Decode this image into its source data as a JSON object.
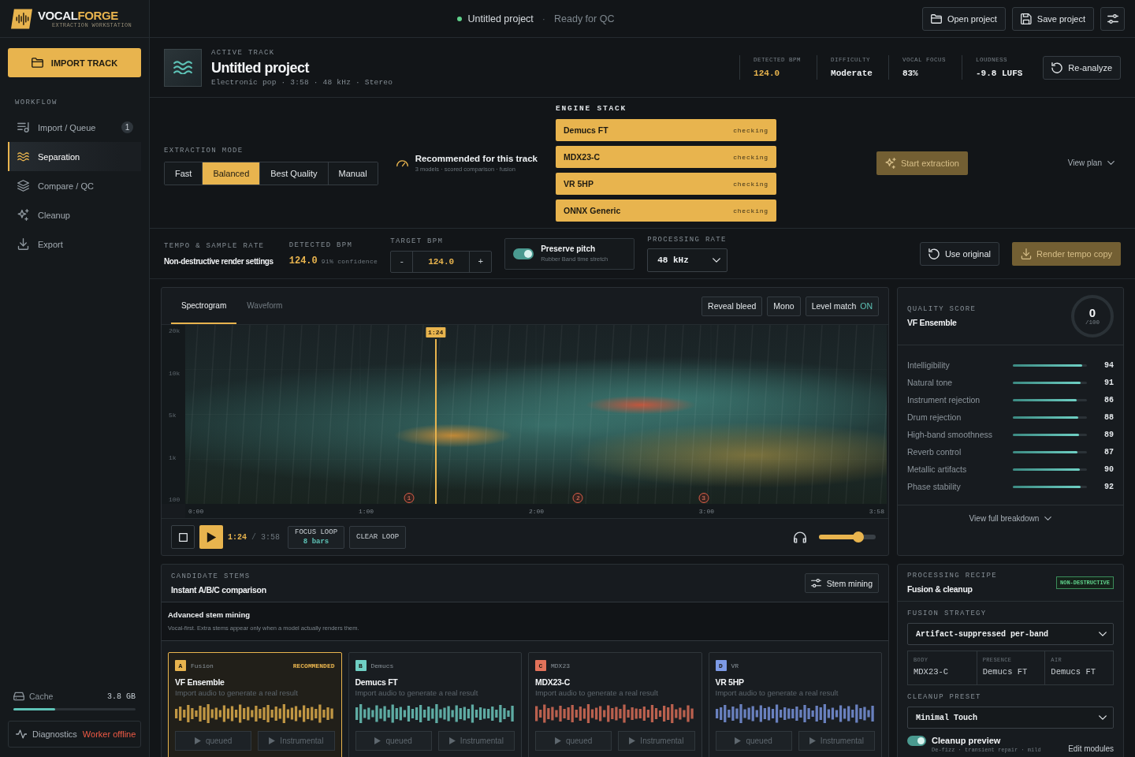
{
  "sidebar": {
    "logo": {
      "name_start": "VOCAL",
      "name_end": "FORGE",
      "tagline": "EXTRACTION WORKSTATION"
    },
    "import_button": "IMPORT TRACK",
    "section_label": "WORKFLOW",
    "items": [
      {
        "label": "Import / Queue",
        "badge": "1",
        "selected": false
      },
      {
        "label": "Separation",
        "selected": true
      },
      {
        "label": "Compare / QC",
        "selected": false
      },
      {
        "label": "Cleanup",
        "selected": false
      },
      {
        "label": "Export",
        "selected": false
      }
    ],
    "cache": {
      "label": "Cache",
      "value": "3.8 GB",
      "level": 0.34
    },
    "diagnostics": {
      "label": "Diagnostics",
      "status": "Worker offline"
    }
  },
  "top_bar": {
    "project": "Untitled project",
    "separator": "·",
    "status": "Ready for QC",
    "buttons": [
      "Open project",
      "Save project"
    ]
  },
  "track": {
    "section_label": "ACTIVE TRACK",
    "title": "Untitled project",
    "meta": "Electronic pop · 3:58 · 48 kHz · Stereo",
    "stats": [
      {
        "label": "DETECTED BPM",
        "value": "124.0",
        "highlight": true
      },
      {
        "label": "DIFFICULTY",
        "value": "Moderate",
        "highlight": false
      },
      {
        "label": "VOCAL FOCUS",
        "value": "83%",
        "highlight": false
      },
      {
        "label": "LOUDNESS",
        "value": "-9.8 LUFS",
        "highlight": false
      }
    ],
    "reanalyze_button": "Re-analyze"
  },
  "extraction": {
    "mode_label": "EXTRACTION MODE",
    "modes": [
      {
        "label": "Fast",
        "selected": false
      },
      {
        "label": "Balanced",
        "selected": true
      },
      {
        "label": "Best Quality",
        "selected": false
      },
      {
        "label": "Manual",
        "selected": false
      }
    ],
    "recommendation": {
      "title": "Recommended for this track",
      "detail": "3 models · scored comparison · fusion"
    },
    "engine_label": "ENGINE STACK",
    "engines": [
      {
        "name": "Demucs FT",
        "status": "checking"
      },
      {
        "name": "MDX23-C",
        "status": "checking"
      },
      {
        "name": "VR 5HP",
        "status": "checking"
      },
      {
        "name": "ONNX Generic",
        "status": "checking"
      }
    ],
    "start_button": {
      "label": "Start extraction",
      "disabled": true
    },
    "view_plan": "View plan"
  },
  "tempo": {
    "title": "TEMPO & SAMPLE RATE",
    "subtitle": "Non-destructive render settings",
    "detected": {
      "label": "DETECTED BPM",
      "value": "124.0",
      "confidence": "91% confidence"
    },
    "target": {
      "label": "TARGET BPM",
      "decrement": "-",
      "value": "124.0",
      "increment": "+"
    },
    "preserve_pitch": {
      "label": "Preserve pitch",
      "detail": "Rubber Band time stretch",
      "on": true
    },
    "rate": {
      "label": "PROCESSING RATE",
      "value": "48 kHz"
    },
    "buttons": [
      {
        "label": "Use original",
        "kind": "reset",
        "disabled": false
      },
      {
        "label": "Render tempo copy",
        "kind": "render",
        "disabled": true
      }
    ]
  },
  "viewer": {
    "tabs": [
      {
        "label": "Spectrogram",
        "selected": true
      },
      {
        "label": "Waveform",
        "selected": false
      }
    ],
    "tools": [
      {
        "label": "Reveal bleed"
      },
      {
        "label": "Mono"
      },
      {
        "label": "Level match",
        "value": "ON"
      }
    ],
    "spectrogram": {
      "y_labels": [
        "20k",
        "10k",
        "5k",
        "1k",
        "100"
      ],
      "x_labels": [
        "0:00",
        "1:00",
        "2:00",
        "3:00",
        "3:58"
      ],
      "playhead": {
        "label": "1:24",
        "level": 0.357
      },
      "markers": [
        "1",
        "2",
        "3"
      ]
    },
    "transport": {
      "time": "1:24",
      "separator": "/",
      "duration": "3:58",
      "focus_loop": {
        "label": "FOCUS LOOP",
        "value": "8 bars"
      },
      "clear_loop": "CLEAR LOOP",
      "volume": {
        "level": 0.7
      }
    }
  },
  "quality": {
    "label": "QUALITY SCORE",
    "model": "VF Ensemble",
    "score": {
      "value": "0",
      "total": "/100"
    },
    "metrics": [
      {
        "name": "Intelligibility",
        "value": "94",
        "level": 0.94
      },
      {
        "name": "Natural tone",
        "value": "91",
        "level": 0.91
      },
      {
        "name": "Instrument rejection",
        "value": "86",
        "level": 0.86
      },
      {
        "name": "Drum rejection",
        "value": "88",
        "level": 0.88
      },
      {
        "name": "High-band smoothness",
        "value": "89",
        "level": 0.89
      },
      {
        "name": "Reverb control",
        "value": "87",
        "level": 0.87
      },
      {
        "name": "Metallic artifacts",
        "value": "90",
        "level": 0.9
      },
      {
        "name": "Phase stability",
        "value": "92",
        "level": 0.92
      }
    ],
    "footer_link": "View full breakdown"
  },
  "stems": {
    "label": "CANDIDATE STEMS",
    "title": "Instant A/B/C comparison",
    "mining_button": "Stem mining",
    "mining": {
      "title": "Advanced stem mining",
      "text": "Vocal-first. Extra stems appear only when a model actually renders them."
    },
    "cards": [
      {
        "letter": "A",
        "family": "Fusion",
        "badge": "RECOMMENDED",
        "name": "VF Ensemble",
        "note": "Import audio to generate a real result",
        "color": "#e8b44e",
        "selected": true,
        "actions": [
          {
            "label": "queued",
            "disabled": true
          },
          {
            "label": "Instrumental",
            "disabled": true
          }
        ]
      },
      {
        "letter": "B",
        "family": "Demucs",
        "name": "Demucs FT",
        "note": "Import audio to generate a real result",
        "color": "#6fcfc4",
        "selected": false,
        "actions": [
          {
            "label": "queued",
            "disabled": true
          },
          {
            "label": "Instrumental",
            "disabled": true
          }
        ]
      },
      {
        "letter": "C",
        "family": "MDX23",
        "name": "MDX23-C",
        "note": "Import audio to generate a real result",
        "color": "#e2725a",
        "selected": false,
        "actions": [
          {
            "label": "queued",
            "disabled": true
          },
          {
            "label": "Instrumental",
            "disabled": true
          }
        ]
      },
      {
        "letter": "D",
        "family": "VR",
        "name": "VR 5HP",
        "note": "Import audio to generate a real result",
        "color": "#7d9ae6",
        "selected": false,
        "actions": [
          {
            "label": "queued",
            "disabled": true
          },
          {
            "label": "Instrumental",
            "disabled": true
          }
        ]
      }
    ]
  },
  "recipe": {
    "label": "PROCESSING RECIPE",
    "title": "Fusion & cleanup",
    "badge": "NON-DESTRUCTIVE",
    "strategy_label": "FUSION STRATEGY",
    "strategy": "Artifact-suppressed per-band",
    "bands": [
      {
        "label": "BODY",
        "value": "MDX23-C"
      },
      {
        "label": "PRESENCE",
        "value": "Demucs FT"
      },
      {
        "label": "AIR",
        "value": "Demucs FT"
      }
    ],
    "preset_label": "CLEANUP PRESET",
    "preset": "Minimal Touch",
    "preview": {
      "label": "Cleanup preview",
      "detail": "De-fizz · transient repair · mild",
      "on": true
    },
    "edit_link": "Edit modules"
  }
}
